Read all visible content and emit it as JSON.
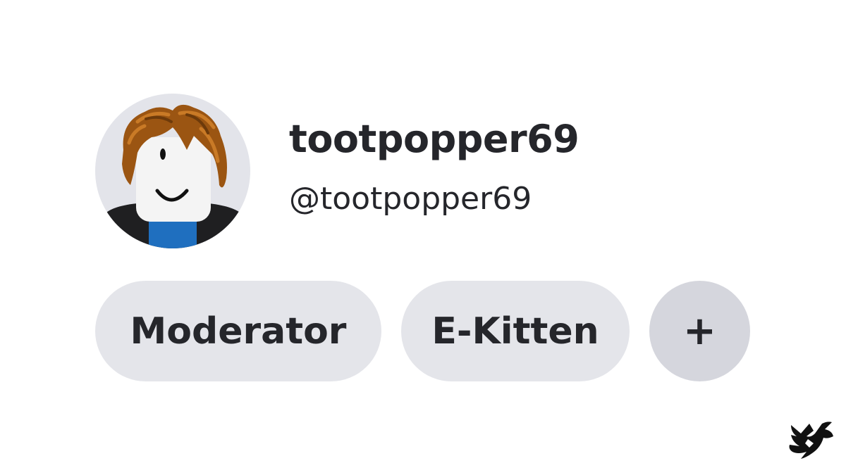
{
  "profile": {
    "display_name": "tootpopper69",
    "handle": "@tootpopper69",
    "avatar_icon": "roblox-avatar-icon"
  },
  "tags": [
    {
      "label": "Moderator"
    },
    {
      "label": "E-Kitten"
    }
  ],
  "add_tag": {
    "label": "+"
  },
  "brand": {
    "icon": "bird-logo-icon"
  },
  "colors": {
    "background": "#ffffff",
    "text": "#25262b",
    "tag_bg": "#e4e5ea",
    "add_bg": "#d5d6dd",
    "avatar_bg": "#e3e4ea"
  }
}
